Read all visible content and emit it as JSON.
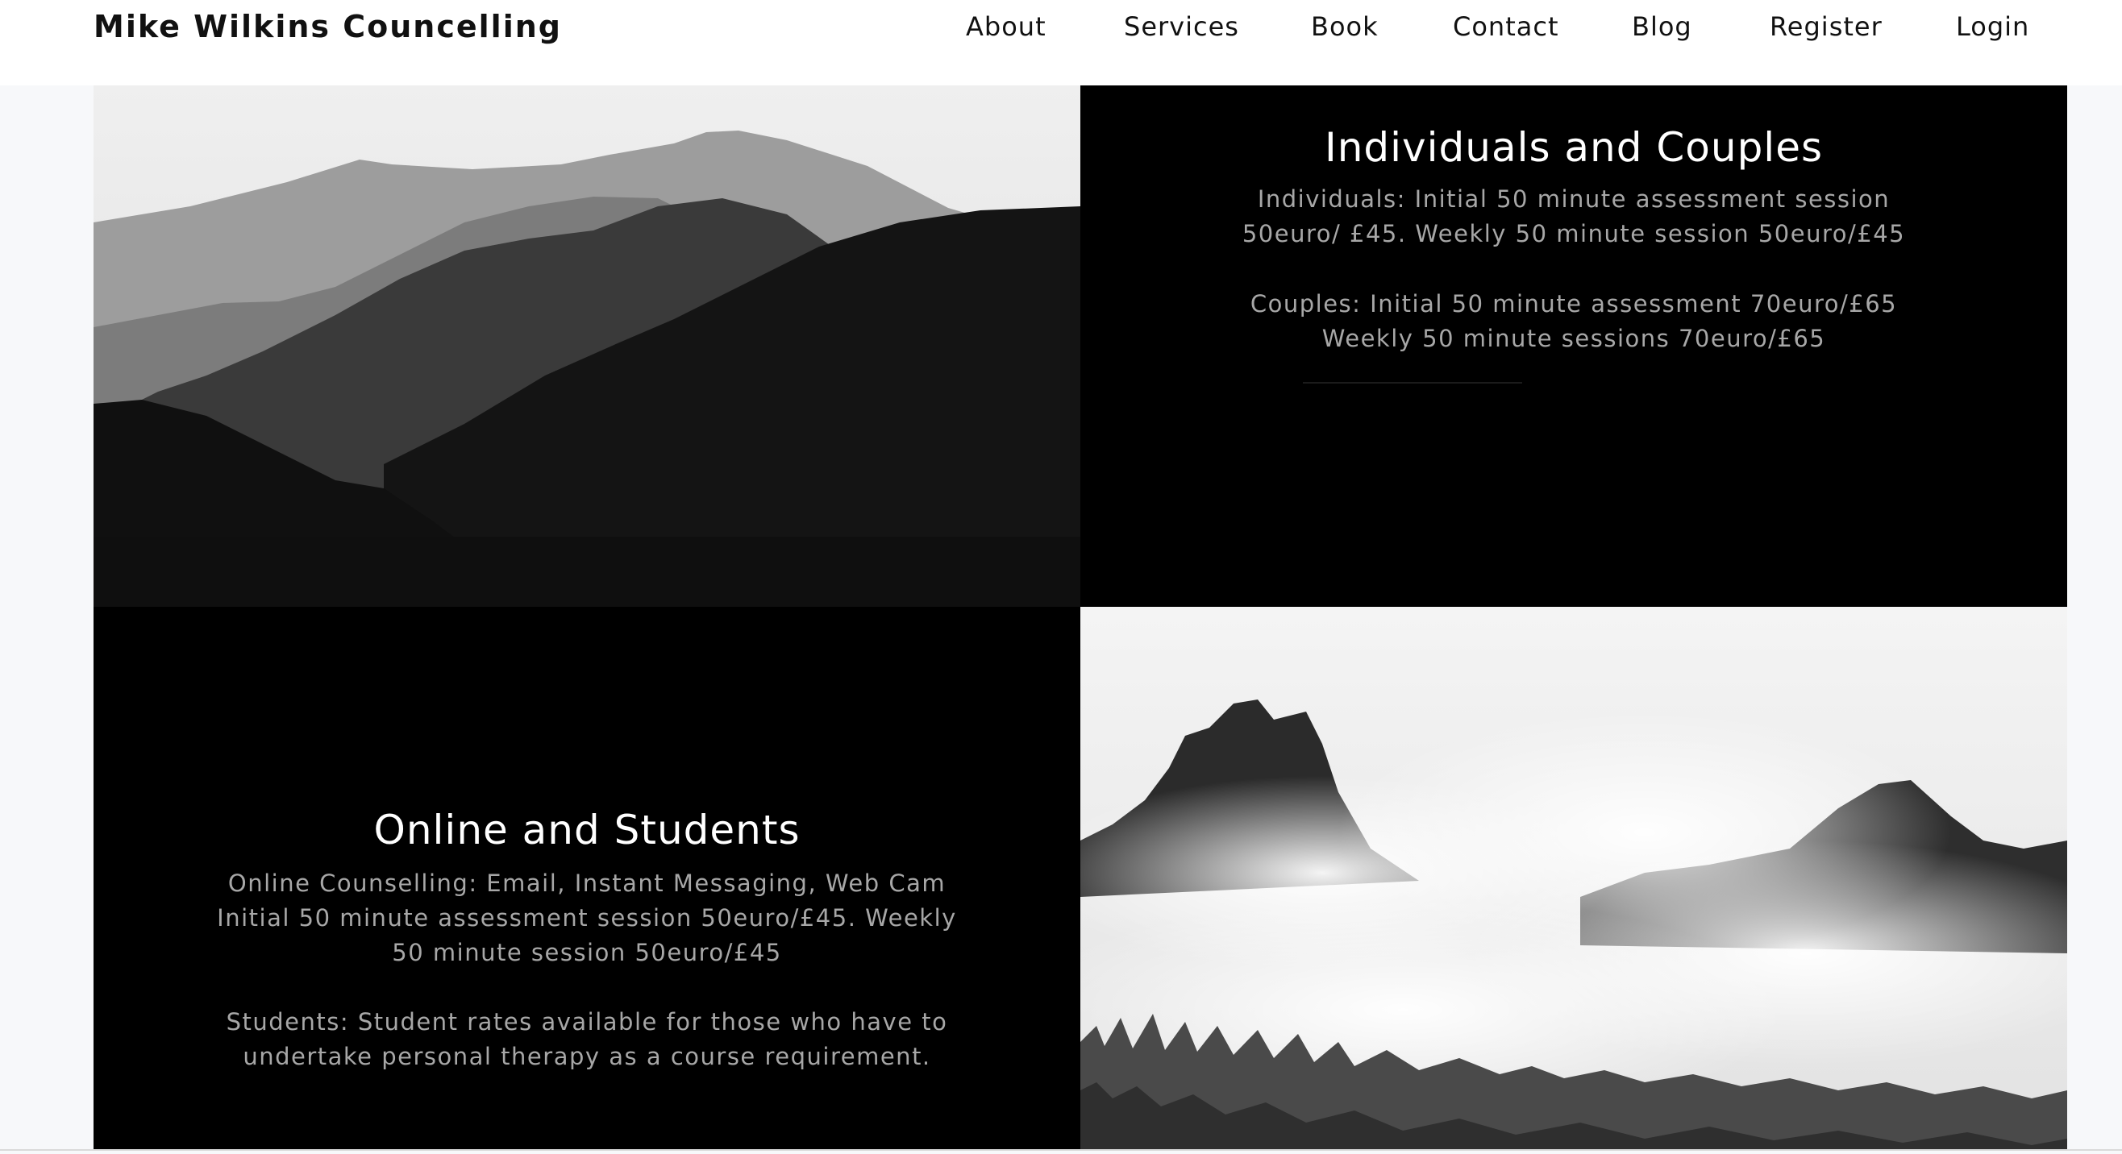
{
  "site": {
    "brand": "Mike Wilkins Councelling"
  },
  "nav": {
    "items": [
      {
        "label": "About"
      },
      {
        "label": "Services"
      },
      {
        "label": "Book"
      },
      {
        "label": "Contact"
      },
      {
        "label": "Blog"
      },
      {
        "label": "Register"
      },
      {
        "label": "Login"
      }
    ]
  },
  "services": {
    "individuals": {
      "title": "Individuals and Couples",
      "text1": "Individuals: Initial 50 minute assessment session 50euro/ £45. Weekly 50 minute session 50euro/£45",
      "text2": "Couples: Initial 50 minute assessment 70euro/£65 Weekly 50 minute sessions 70euro/£65"
    },
    "online": {
      "title": "Online and Students",
      "text1": "Online Counselling: Email, Instant Messaging, Web Cam Initial 50 minute assessment session 50euro/£45. Weekly 50 minute session 50euro/£45",
      "text2": "Students: Student rates available for those who have to undertake personal therapy as a course requirement."
    }
  },
  "images": {
    "top_left": "mountain-ridges-photo",
    "bottom_right": "misty-peaks-photo"
  },
  "colors": {
    "header_bg": "#ffffff",
    "panel_bg": "#000000",
    "panel_title": "#ffffff",
    "panel_text": "#a7a7a7",
    "page_bg": "#f7f8fa"
  }
}
